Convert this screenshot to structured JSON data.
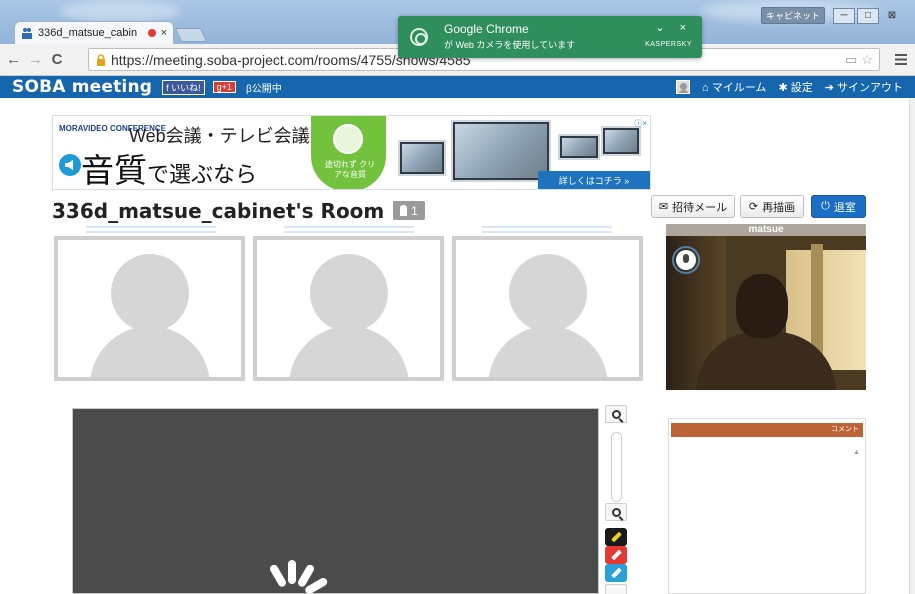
{
  "browser": {
    "tab_title": "336d_matsue_cabin",
    "tab_close": "×",
    "url": "https://meeting.soba-project.com/rooms/4755/shows/4585",
    "window_tool_label": "キャピネット",
    "window_buttons": {
      "minimize": "─",
      "maximize": "□",
      "close": "⊠"
    },
    "nav": {
      "back": "←",
      "forward": "→",
      "reload": "C"
    }
  },
  "notification": {
    "title": "Google Chrome",
    "message": "が Web カメラを使用しています",
    "controls": "⌄ ×",
    "source": "KASPERSKY"
  },
  "site_header": {
    "logo": "SOBA meeting",
    "fb_label": "f いいね!",
    "gplus_label": "g+1",
    "beta_label": "β公開中",
    "links": [
      {
        "icon": "home-icon",
        "glyph": "⌂",
        "label": "マイルーム"
      },
      {
        "icon": "gear-icon",
        "glyph": "✱",
        "label": "設定"
      },
      {
        "icon": "signout-icon",
        "glyph": "➔",
        "label": "サインアウト"
      }
    ]
  },
  "banner": {
    "brand": "MORAVIDEO CONFERENCE",
    "headline": "Web会議・テレビ会議",
    "big_text_a": "音質",
    "big_text_b": "で選ぶなら",
    "badge_text": "途切れず クリアな音質",
    "cta": "詳しくはコチラ »",
    "ad_mark": "ⓘ×"
  },
  "room": {
    "title": "336d_matsue_cabinet's Room",
    "member_count": "1",
    "buttons": [
      {
        "id": "invite",
        "glyph": "✉",
        "label": "招待メール"
      },
      {
        "id": "redraw",
        "glyph": "⟳",
        "label": "再描画"
      },
      {
        "id": "leave",
        "glyph": "⏻",
        "label": "退室"
      }
    ]
  },
  "self_video": {
    "name": "matsue"
  },
  "comment_panel": {
    "header": "コメント",
    "scroll_up": "▲"
  },
  "tools": {
    "pen_colors": [
      "#1a1a1a",
      "#e53935",
      "#2aa1d6"
    ],
    "pen_highlight": "#f2d21a"
  }
}
